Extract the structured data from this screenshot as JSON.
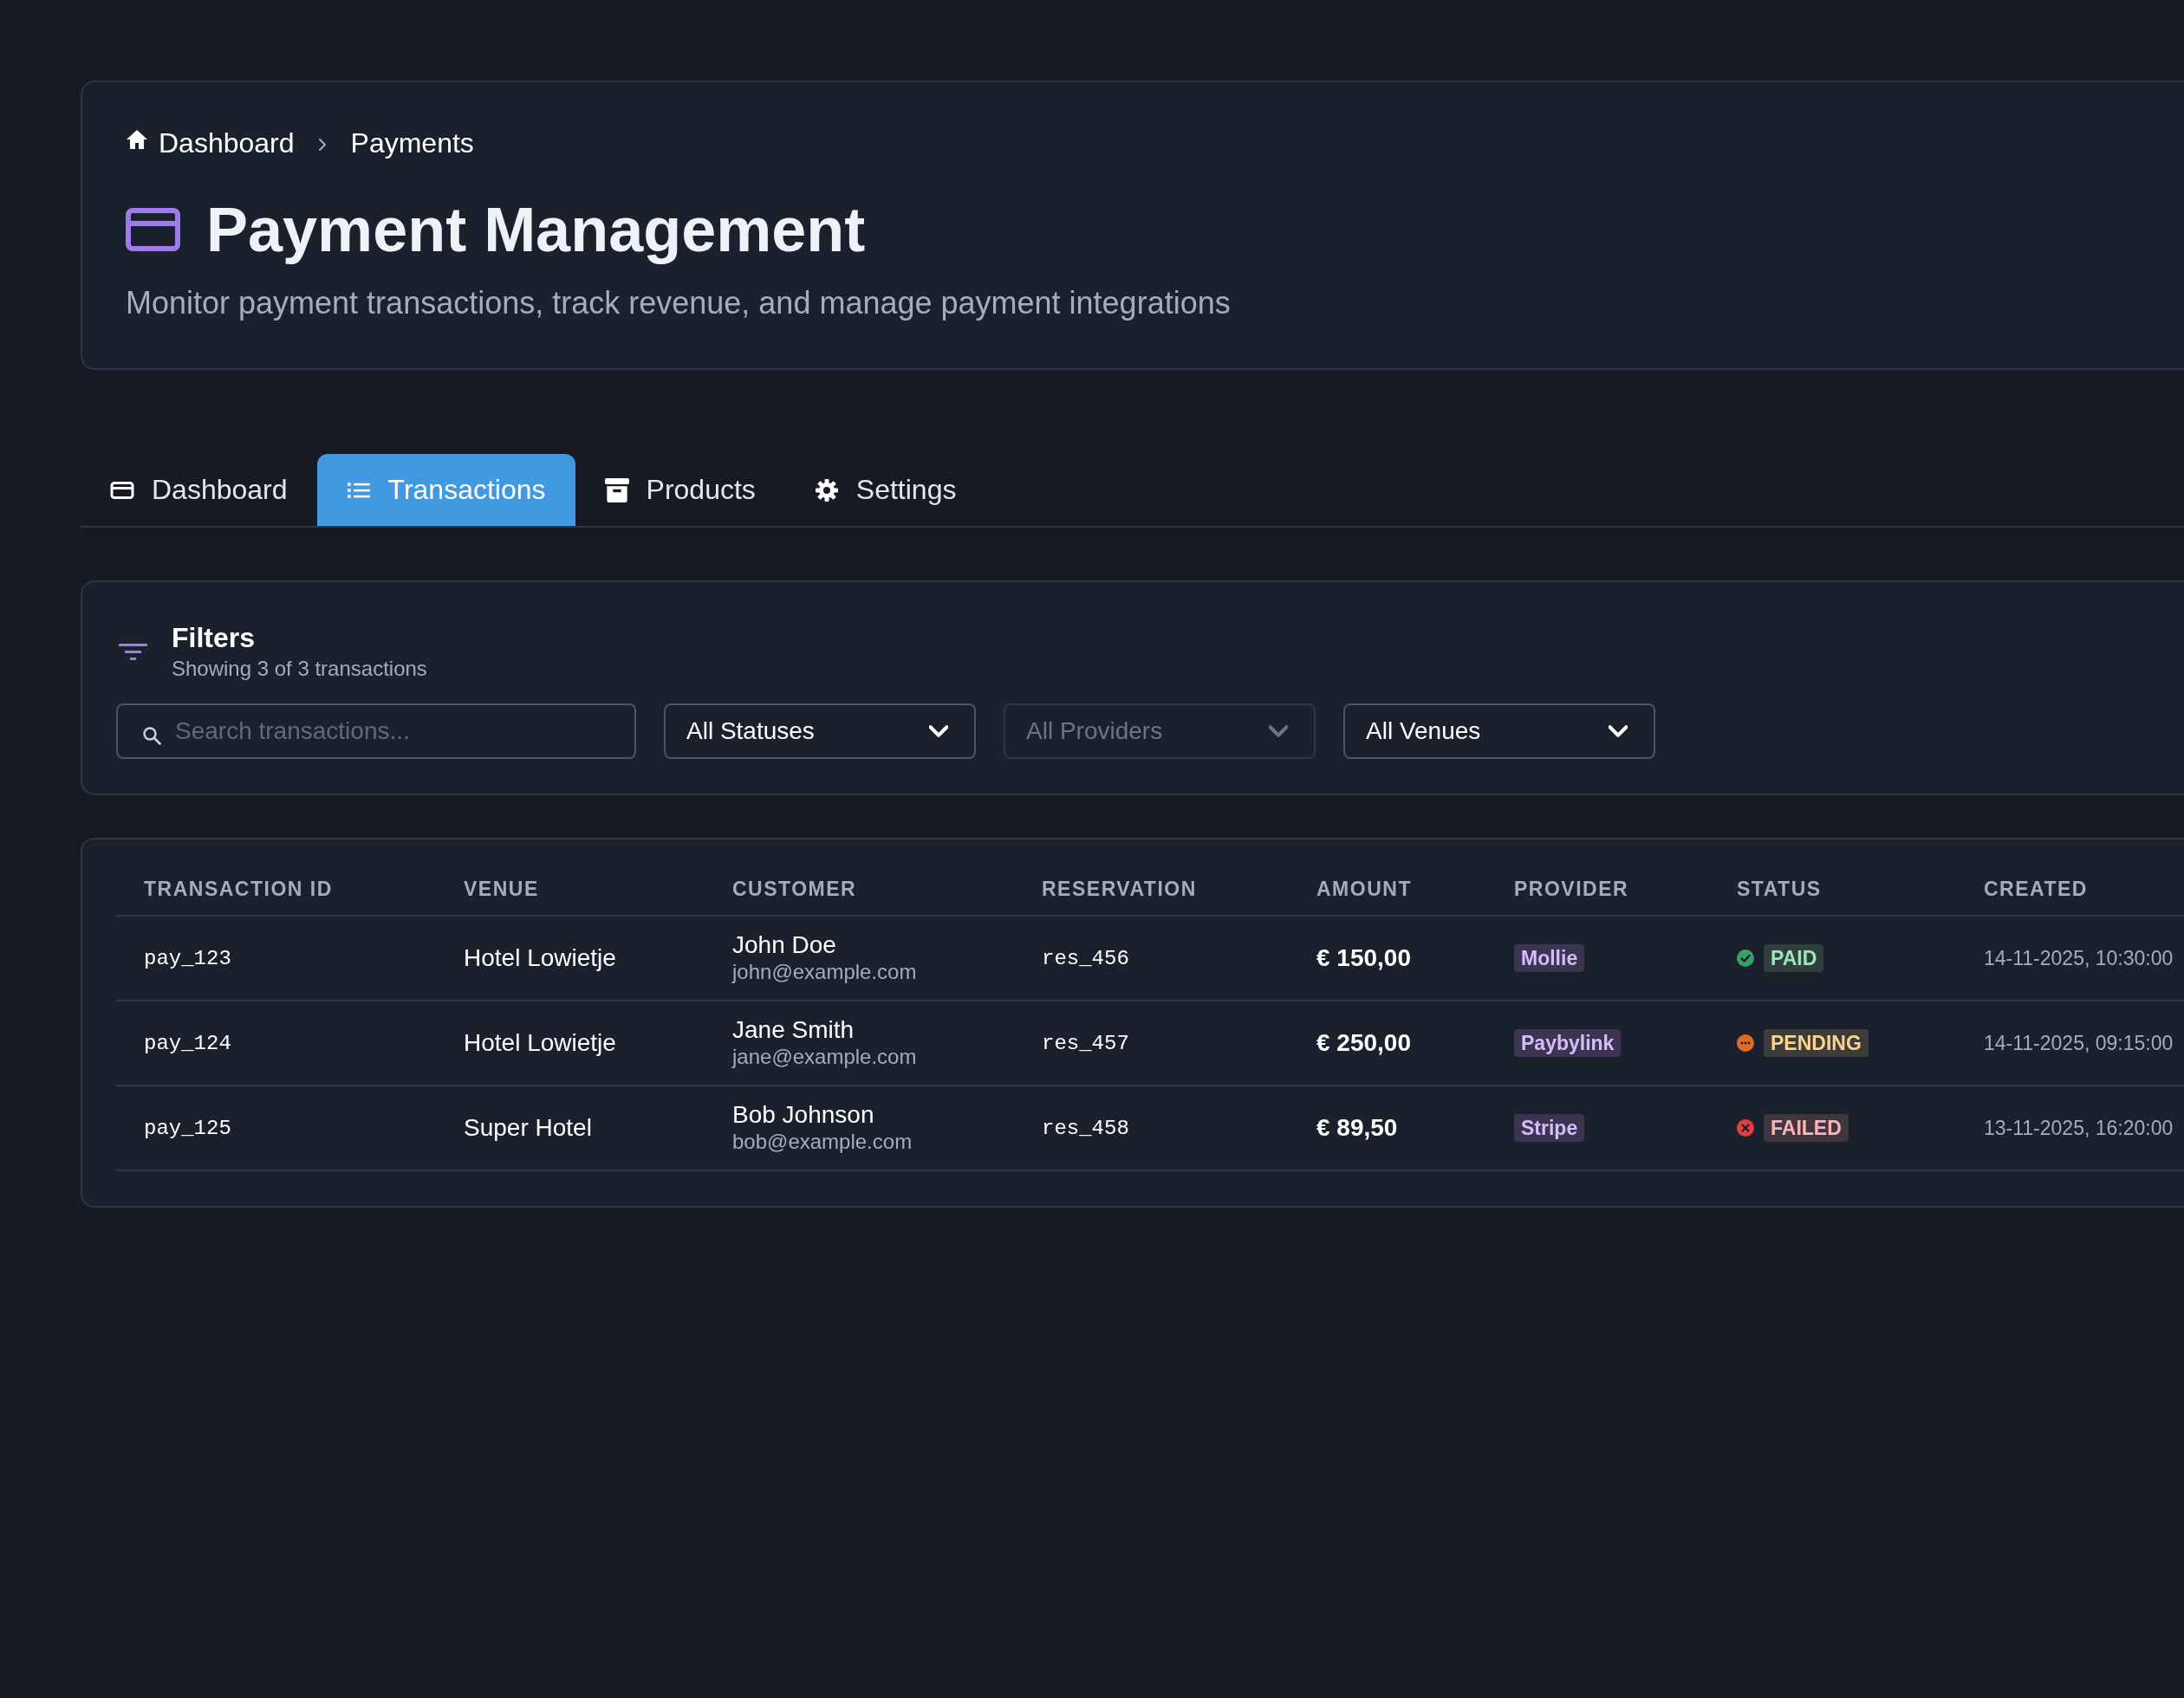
{
  "breadcrumb": [
    {
      "label": "Dashboard"
    },
    {
      "label": "Payments"
    }
  ],
  "header": {
    "title": "Payment Management",
    "subtitle": "Monitor payment transactions, track revenue, and manage payment integrations"
  },
  "tabs": [
    {
      "label": "Dashboard",
      "selected": false
    },
    {
      "label": "Transactions",
      "selected": true
    },
    {
      "label": "Products",
      "selected": false
    },
    {
      "label": "Settings",
      "selected": false
    }
  ],
  "filters": {
    "title": "Filters",
    "summary": "Showing 3 of 3 transactions",
    "search": {
      "placeholder": "Search transactions..."
    },
    "selects": [
      {
        "value": "All Statuses",
        "disabled": false
      },
      {
        "value": "All Providers",
        "disabled": true
      },
      {
        "value": "All Venues",
        "disabled": false
      }
    ]
  },
  "table": {
    "columns": [
      "TRANSACTION ID",
      "VENUE",
      "CUSTOMER",
      "RESERVATION",
      "AMOUNT",
      "PROVIDER",
      "STATUS",
      "CREATED"
    ],
    "rows": [
      {
        "transaction_id": "pay_123",
        "venue": "Hotel Lowietje",
        "customer": {
          "name": "John Doe",
          "email": "john@example.com"
        },
        "reservation": "res_456",
        "amount": "€ 150,00",
        "provider": "Mollie",
        "status": {
          "label": "PAID",
          "kind": "paid"
        },
        "created": "14-11-2025, 10:30:00"
      },
      {
        "transaction_id": "pay_124",
        "venue": "Hotel Lowietje",
        "customer": {
          "name": "Jane Smith",
          "email": "jane@example.com"
        },
        "reservation": "res_457",
        "amount": "€ 250,00",
        "provider": "Paybylink",
        "status": {
          "label": "PENDING",
          "kind": "pending"
        },
        "created": "14-11-2025, 09:15:00"
      },
      {
        "transaction_id": "pay_125",
        "venue": "Super Hotel",
        "customer": {
          "name": "Bob Johnson",
          "email": "bob@example.com"
        },
        "reservation": "res_458",
        "amount": "€ 89,50",
        "provider": "Stripe",
        "status": {
          "label": "FAILED",
          "kind": "failed"
        },
        "created": "13-11-2025, 16:20:00"
      }
    ]
  }
}
